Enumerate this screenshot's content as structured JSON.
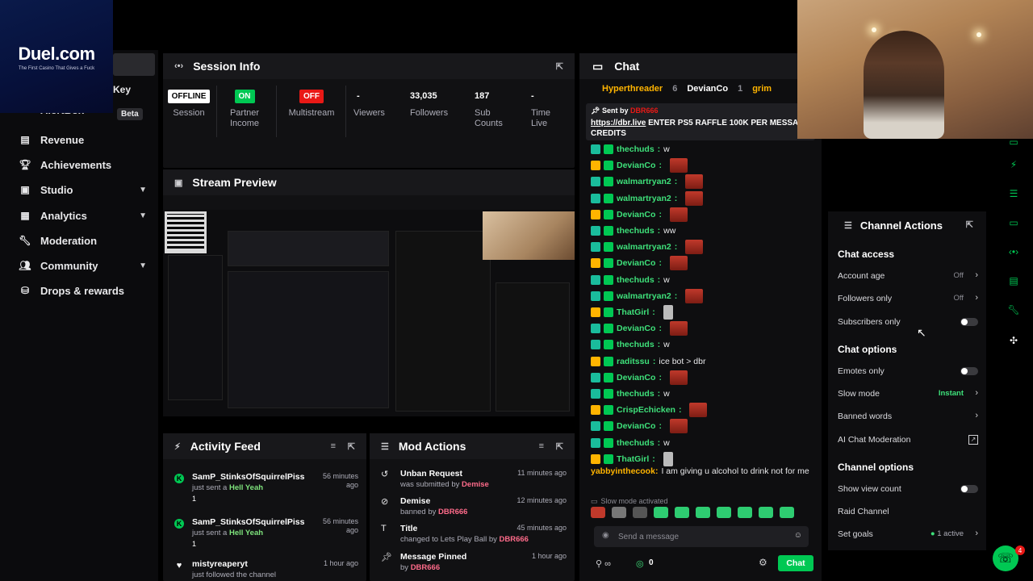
{
  "logo": {
    "brand": "Duel.com",
    "tagline": "The First Casino That Gives a Fuck"
  },
  "sidebar": {
    "key_label": "Key",
    "partial_item": "AlertBox",
    "beta": "Beta",
    "items": [
      {
        "label": "Revenue",
        "icon": "revenue-icon",
        "chevron": false
      },
      {
        "label": "Achievements",
        "icon": "trophy-icon",
        "chevron": false
      },
      {
        "label": "Studio",
        "icon": "studio-icon",
        "chevron": true
      },
      {
        "label": "Analytics",
        "icon": "analytics-icon",
        "chevron": true
      },
      {
        "label": "Moderation",
        "icon": "wrench-icon",
        "chevron": false
      },
      {
        "label": "Community",
        "icon": "community-icon",
        "chevron": true
      },
      {
        "label": "Drops & rewards",
        "icon": "drops-icon",
        "chevron": false
      }
    ]
  },
  "session_info": {
    "title": "Session Info",
    "stats": [
      {
        "value": "OFFLINE",
        "label": "Session",
        "style": "offline"
      },
      {
        "value": "ON",
        "label": "Partner Income",
        "style": "on"
      },
      {
        "value": "OFF",
        "label": "Multistream",
        "style": "off"
      },
      {
        "value": "-",
        "label": "Viewers"
      },
      {
        "value": "33,035",
        "label": "Followers"
      },
      {
        "value": "187",
        "label": "Sub Counts"
      },
      {
        "value": "-",
        "label": "Time Live"
      }
    ]
  },
  "stream_preview": {
    "title": "Stream Preview"
  },
  "activity_feed": {
    "title": "Activity Feed",
    "items": [
      {
        "name": "SamP_StinksOfSquirrelPiss",
        "action": "just sent a",
        "gift": "Hell Yeah",
        "count": "1",
        "time": "56 minutes ago"
      },
      {
        "name": "SamP_StinksOfSquirrelPiss",
        "action": "just sent a",
        "gift": "Hell Yeah",
        "count": "1",
        "time": "56 minutes ago"
      },
      {
        "name": "mistyreaperyt",
        "action": "just followed the channel",
        "gift": "",
        "count": "",
        "time": "1 hour ago"
      }
    ]
  },
  "mod_actions": {
    "title": "Mod Actions",
    "items": [
      {
        "name": "Unban Request",
        "action": "was submitted by",
        "by": "Demise",
        "time": "11 minutes ago",
        "icon": "history-icon"
      },
      {
        "name": "Demise",
        "action": "banned by",
        "by": "DBR666",
        "time": "12 minutes ago",
        "icon": "ban-icon"
      },
      {
        "name": "Title",
        "action": "changed to Lets Play Ball by",
        "by": "DBR666",
        "time": "45 minutes ago",
        "icon": "title-icon"
      },
      {
        "name": "Message Pinned",
        "action": "by",
        "by": "DBR666",
        "time": "1 hour ago",
        "icon": "pin-icon"
      }
    ]
  },
  "chat": {
    "title": "Chat",
    "gifters": [
      "Hyperthreader",
      "6",
      "DevianCo",
      "1",
      "grim"
    ],
    "pinned": {
      "sent_by": "Sent by",
      "author": "DBR666",
      "link": "https://dbr.live",
      "message": "ENTER PS5 RAFFLE 100K PER MESSAGE CREDITS"
    },
    "lines": [
      {
        "user": "thechuds",
        "text": "w"
      },
      {
        "user": "DevianCo",
        "text": ""
      },
      {
        "user": "walmartryan2",
        "text": ""
      },
      {
        "user": "walmartryan2",
        "text": ""
      },
      {
        "user": "DevianCo",
        "text": ""
      },
      {
        "user": "thechuds",
        "text": "ww"
      },
      {
        "user": "walmartryan2",
        "text": ""
      },
      {
        "user": "DevianCo",
        "text": ""
      },
      {
        "user": "thechuds",
        "text": "w"
      },
      {
        "user": "walmartryan2",
        "text": ""
      },
      {
        "user": "ThatGirl",
        "text": ""
      },
      {
        "user": "DevianCo",
        "text": ""
      },
      {
        "user": "thechuds",
        "text": "w"
      },
      {
        "user": "raditssu",
        "text": "ice bot > dbr"
      },
      {
        "user": "DevianCo",
        "text": ""
      },
      {
        "user": "thechuds",
        "text": "w"
      },
      {
        "user": "CrispEchicken",
        "text": ""
      },
      {
        "user": "DevianCo",
        "text": ""
      },
      {
        "user": "thechuds",
        "text": "w"
      },
      {
        "user": "ThatGirl",
        "text": ""
      }
    ],
    "last_message": {
      "user": "yabbyinthecook",
      "text": "I am giving u alcohol to drink not for me"
    },
    "slow_mode_notice": "Slow mode activated",
    "input_placeholder": "Send a message",
    "count": "0",
    "send_label": "Chat"
  },
  "channel_actions": {
    "title": "Channel Actions",
    "chat_access": {
      "title": "Chat access",
      "rows": [
        {
          "label": "Account age",
          "value": "Off",
          "kind": "chevron"
        },
        {
          "label": "Followers only",
          "value": "Off",
          "kind": "chevron"
        },
        {
          "label": "Subscribers only",
          "value": "",
          "kind": "toggle"
        }
      ]
    },
    "chat_options": {
      "title": "Chat options",
      "rows": [
        {
          "label": "Emotes only",
          "value": "",
          "kind": "toggle"
        },
        {
          "label": "Slow mode",
          "value": "Instant",
          "kind": "chevron"
        },
        {
          "label": "Banned words",
          "value": "",
          "kind": "chevron"
        },
        {
          "label": "AI Chat Moderation",
          "value": "",
          "kind": "external"
        }
      ]
    },
    "channel_options": {
      "title": "Channel options",
      "rows": [
        {
          "label": "Show view count",
          "value": "",
          "kind": "toggle"
        },
        {
          "label": "Raid Channel",
          "value": "",
          "kind": "none"
        },
        {
          "label": "Set goals",
          "value": "1 active",
          "kind": "chevron"
        }
      ]
    }
  },
  "help_badge": "4",
  "colors": {
    "accent": "#00c853",
    "danger": "#e91916",
    "panel": "#111113",
    "header": "#18181b"
  }
}
